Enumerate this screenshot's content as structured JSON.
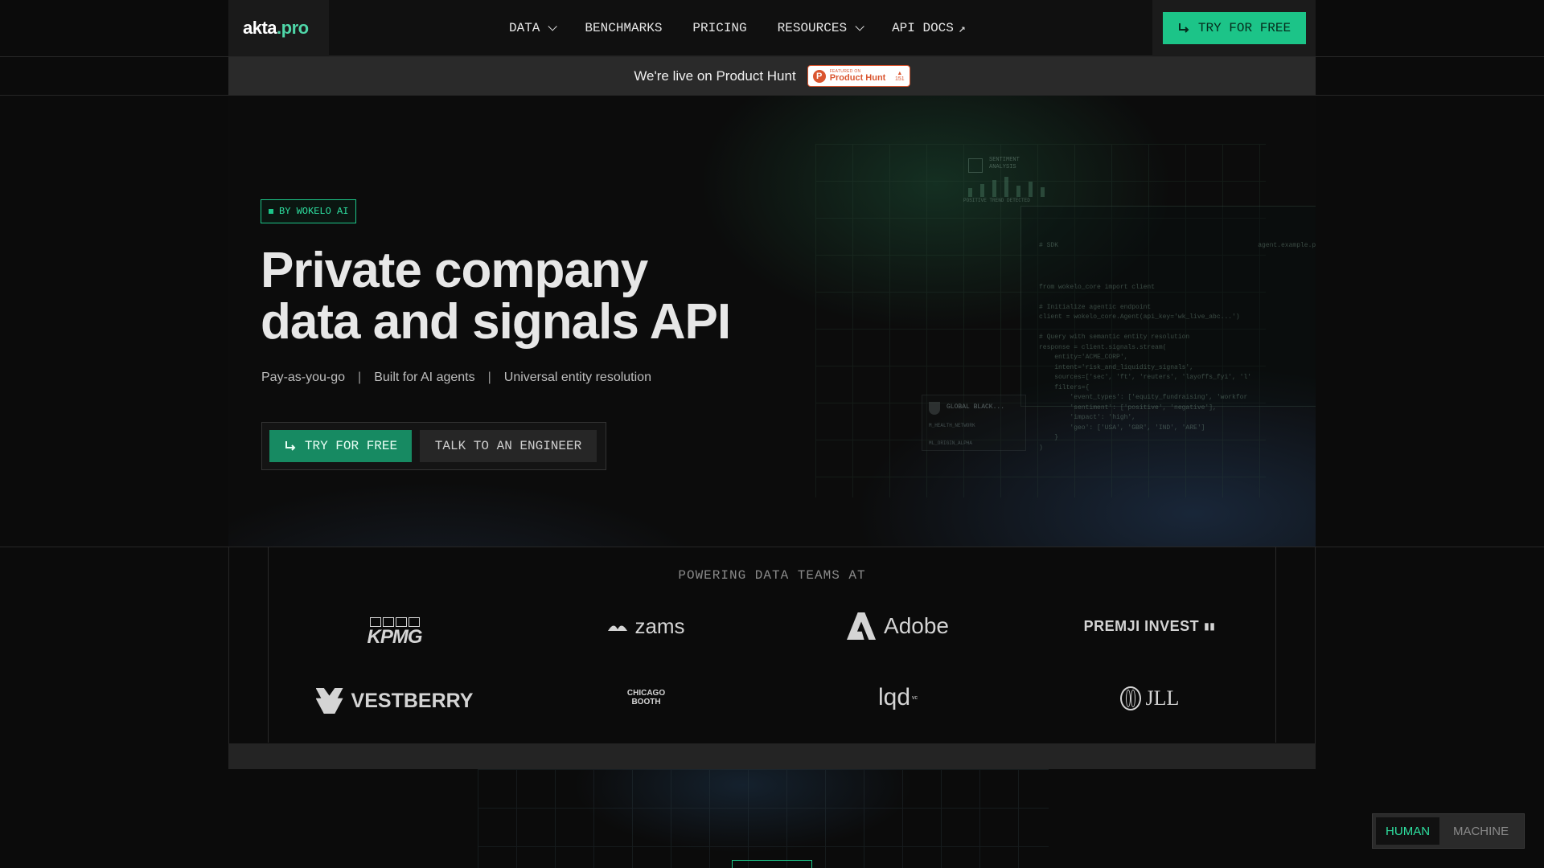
{
  "nav": {
    "logo_main": "akta",
    "logo_accent": ".pro",
    "links": [
      {
        "label": "DATA",
        "dropdown": true
      },
      {
        "label": "BENCHMARKS",
        "dropdown": false
      },
      {
        "label": "PRICING",
        "dropdown": false
      },
      {
        "label": "RESOURCES",
        "dropdown": true
      },
      {
        "label": "API DOCS",
        "external": true,
        "ext_glyph": "↗"
      }
    ],
    "cta_label": "TRY FOR FREE"
  },
  "banner": {
    "text": "We're live on Product Hunt",
    "badge": {
      "featured": "FEATURED ON",
      "name": "Product Hunt",
      "votes": "151",
      "arrow": "▲",
      "logo_letter": "P"
    }
  },
  "hero": {
    "tag": "BY WOKELO AI",
    "title_line1": "Private company",
    "title_line2": "data and signals API",
    "features": [
      "Pay-as-you-go",
      "Built for AI agents",
      "Universal entity resolution"
    ],
    "separator": "|",
    "primary_cta": "TRY FOR FREE",
    "secondary_cta": "TALK TO AN ENGINEER"
  },
  "visual": {
    "sentiment_label": "SENTIMENT\nANALYSIS",
    "sentiment_caption": "POSITIVE TREND DETECTED",
    "sentiment_bars": [
      30,
      45,
      60,
      70,
      40,
      55,
      35
    ],
    "code_header_left": "# SDK",
    "code_header_right": "agent.example.py",
    "code_body": "from wokelo_core import client\n\n# Initialize agentic endpoint\nclient = wokelo_core.Agent(api_key='wk_live_abc...')\n\n# Query with semantic entity resolution\nresponse = client.signals.stream(\n    entity='ACME_CORP',\n    intent='risk_and_liquidity_signals',\n    sources=['sec', 'ft', 'reuters', 'layoffs_fyi', 'l'\n    filters={\n        'event_types': ['equity_fundraising', 'workfor\n        'sentiment': ['positive', 'negative'],\n        'impact': 'high',\n        'geo': ['USA', 'GBR', 'IND', 'ARE']\n    }\n)",
    "gb_label": "GLOBAL BLACK...",
    "gb_line1": "M_HEALTH_NETWORK",
    "gb_line2": "ML_ORIGIN_ALPHA"
  },
  "logos": {
    "title": "POWERING DATA TEAMS AT",
    "items": [
      {
        "name": "KPMG"
      },
      {
        "name": "zams"
      },
      {
        "name": "Adobe"
      },
      {
        "name": "PREMJI INVEST",
        "mark": "▮▮"
      },
      {
        "name": "VESTBERRY"
      },
      {
        "name_line1": "CHICAGO",
        "name_line2": "BOOTH"
      },
      {
        "name": "lqd",
        "sup": "vc"
      },
      {
        "name": "JLL"
      }
    ]
  },
  "toggle": {
    "active": "HUMAN",
    "inactive": "MACHINE"
  },
  "colors": {
    "accent": "#1cc488",
    "accent_text": "#2ee0a0",
    "bg": "#0b0b0b",
    "product_hunt": "#da552f"
  }
}
